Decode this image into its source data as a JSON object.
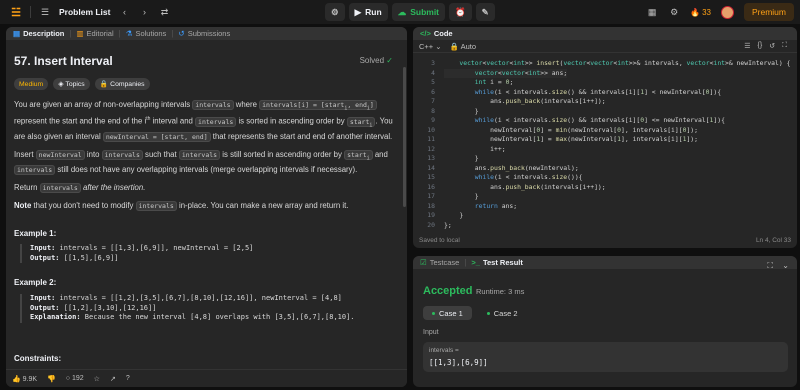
{
  "topbar": {
    "title": "Problem List",
    "run_label": "Run",
    "submit_label": "Submit",
    "streak": "33",
    "premium_label": "Premium"
  },
  "left_tabs": [
    "Description",
    "Editorial",
    "Solutions",
    "Submissions"
  ],
  "problem": {
    "title": "57. Insert Interval",
    "status": "Solved",
    "difficulty": "Medium",
    "topics": "Topics",
    "companies": "Companies",
    "p1a": "You are given an array of non-overlapping intervals",
    "p1code1": "intervals",
    "p1b": "where",
    "p1code2": "intervals[i] = [start",
    "p1code2b": ", end",
    "p1code2c": "]",
    "p1c": "represent the start and the end of the",
    "p1d": "interval and",
    "p1code3": "intervals",
    "p1e": "is sorted in ascending order by",
    "p1code4": "start",
    "p1f": ". You are also given an interval",
    "p1code5": "newInterval = [start, end]",
    "p1g": "that represents the start and end of another interval.",
    "p2a": "Insert",
    "p2code1": "newInterval",
    "p2b": "into",
    "p2code2": "intervals",
    "p2c": "such that",
    "p2code3": "intervals",
    "p2d": "is still sorted in ascending order by",
    "p2code4": "start",
    "p2e": "and",
    "p2code5": "intervals",
    "p2f": "still does not have any overlapping intervals (merge overlapping intervals if necessary).",
    "p3a": "Return",
    "p3code": "intervals",
    "p3b": "after the insertion.",
    "p4bold": "Note",
    "p4a": "that you don't need to modify",
    "p4code": "intervals",
    "p4b": "in-place. You can make a new array and return it.",
    "ex1_title": "Example 1:",
    "ex1_input_label": "Input:",
    "ex1_input": "intervals = [[1,3],[6,9]], newInterval = [2,5]",
    "ex1_output_label": "Output:",
    "ex1_output": "[[1,5],[6,9]]",
    "ex2_title": "Example 2:",
    "ex2_input_label": "Input:",
    "ex2_input": "intervals = [[1,2],[3,5],[6,7],[8,10],[12,16]], newInterval = [4,8]",
    "ex2_output_label": "Output:",
    "ex2_output": "[[1,2],[3,10],[12,16]]",
    "ex2_expl_label": "Explanation:",
    "ex2_expl": "Because the new interval [4,8] overlaps with [3,5],[6,7],[8,10].",
    "constraints": "Constraints:",
    "likes": "9.9K",
    "comments": "192"
  },
  "code": {
    "tab": "Code",
    "language": "C++",
    "auto": "Auto",
    "lines": [
      {
        "n": "3",
        "t": "    vector<vector<int>> insert(vector<vector<int>>& intervals, vector<int>& newInterval) {"
      },
      {
        "n": "4",
        "t": "        vector<vector<int>> ans;"
      },
      {
        "n": "5",
        "t": "        int i = 0;"
      },
      {
        "n": "6",
        "t": "        while(i < intervals.size() && intervals[i][1] < newInterval[0]){"
      },
      {
        "n": "7",
        "t": "            ans.push_back(intervals[i++]);"
      },
      {
        "n": "8",
        "t": "        }"
      },
      {
        "n": "9",
        "t": "        while(i < intervals.size() && intervals[i][0] <= newInterval[1]){"
      },
      {
        "n": "10",
        "t": "            newInterval[0] = min(newInterval[0], intervals[i][0]);"
      },
      {
        "n": "11",
        "t": "            newInterval[1] = max(newInterval[1], intervals[i][1]);"
      },
      {
        "n": "12",
        "t": "            i++;"
      },
      {
        "n": "13",
        "t": "        }"
      },
      {
        "n": "14",
        "t": "        ans.push_back(newInterval);"
      },
      {
        "n": "15",
        "t": "        while(i < intervals.size()){"
      },
      {
        "n": "16",
        "t": "            ans.push_back(intervals[i++]);"
      },
      {
        "n": "17",
        "t": "        }"
      },
      {
        "n": "18",
        "t": "        return ans;"
      },
      {
        "n": "19",
        "t": "    }"
      },
      {
        "n": "20",
        "t": "};"
      }
    ],
    "status": "Saved to local",
    "position": "Ln 4, Col 33"
  },
  "test": {
    "tab1": "Testcase",
    "tab2": "Test Result",
    "result": "Accepted",
    "runtime": "Runtime: 3 ms",
    "case1": "Case 1",
    "case2": "Case 2",
    "input_label": "Input",
    "var": "intervals =",
    "value": "[[1,3],[6,9]]"
  }
}
